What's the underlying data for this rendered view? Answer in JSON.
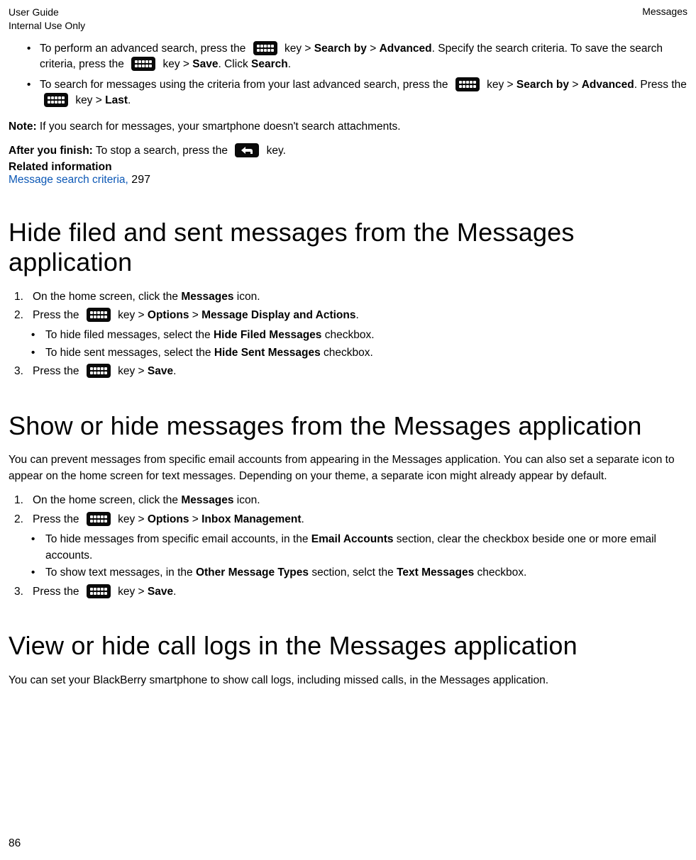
{
  "header": {
    "left1": "User Guide",
    "left2": "Internal Use Only",
    "right": "Messages"
  },
  "intro_bullets": {
    "b1_seg1": "To perform an advanced search, press the ",
    "b1_seg2": " key > ",
    "b1_searchby": "Search by",
    "b1_seg3": " > ",
    "b1_advanced": "Advanced",
    "b1_seg4": ". Specify the search criteria. To save the search criteria, press the ",
    "b1_seg5": " key > ",
    "b1_save": "Save",
    "b1_seg6": ". Click ",
    "b1_search": "Search",
    "b1_seg7": ".",
    "b2_seg1": "To search for messages using the criteria from your last advanced search, press the ",
    "b2_seg2": " key > ",
    "b2_searchby": "Search by",
    "b2_seg3": " > ",
    "b2_advanced": "Advanced",
    "b2_seg4": ". Press the ",
    "b2_seg5": " key > ",
    "b2_last": "Last",
    "b2_seg6": "."
  },
  "note": {
    "label": "Note:",
    "text": " If you search for messages, your smartphone doesn't search attachments."
  },
  "after_finish": {
    "label": "After you finish:",
    "seg1": " To stop a search, press the ",
    "seg2": " key."
  },
  "related": {
    "label": "Related information",
    "link_text": "Message search criteria,",
    "page_ref": " 297"
  },
  "section1": {
    "title": "Hide filed and sent messages from the Messages application",
    "step1_seg1": "On the home screen, click the ",
    "step1_bold": "Messages",
    "step1_seg2": " icon.",
    "step2_seg1": "Press the ",
    "step2_seg2": " key > ",
    "step2_options": "Options",
    "step2_seg3": " > ",
    "step2_target": "Message Display and Actions",
    "step2_seg4": ".",
    "sb1_seg1": "To hide filed messages, select the ",
    "sb1_bold": "Hide Filed Messages",
    "sb1_seg2": " checkbox.",
    "sb2_seg1": "To hide sent messages, select the ",
    "sb2_bold": "Hide Sent Messages",
    "sb2_seg2": " checkbox.",
    "step3_seg1": "Press the ",
    "step3_seg2": " key > ",
    "step3_save": "Save",
    "step3_seg3": "."
  },
  "section2": {
    "title": "Show or hide messages from the Messages application",
    "desc": "You can prevent messages from specific email accounts from appearing in the Messages application. You can also set a separate icon to appear on the home screen for text messages. Depending on your theme, a separate icon might already appear by default.",
    "step1_seg1": "On the home screen, click the ",
    "step1_bold": "Messages",
    "step1_seg2": " icon.",
    "step2_seg1": "Press the ",
    "step2_seg2": " key > ",
    "step2_options": "Options",
    "step2_seg3": " > ",
    "step2_target": "Inbox Management",
    "step2_seg4": ".",
    "sb1_seg1": "To hide messages from specific email accounts, in the ",
    "sb1_bold": "Email Accounts",
    "sb1_seg2": " section, clear the checkbox beside one or more email accounts.",
    "sb2_seg1": "To show text messages, in the ",
    "sb2_bold1": "Other Message Types",
    "sb2_seg2": " section, selct the ",
    "sb2_bold2": "Text Messages",
    "sb2_seg3": " checkbox.",
    "step3_seg1": "Press the ",
    "step3_seg2": " key > ",
    "step3_save": "Save",
    "step3_seg3": "."
  },
  "section3": {
    "title": "View or hide call logs in the Messages application",
    "desc": "You can set your BlackBerry smartphone to show call logs, including missed calls, in the Messages application."
  },
  "page_number": "86"
}
